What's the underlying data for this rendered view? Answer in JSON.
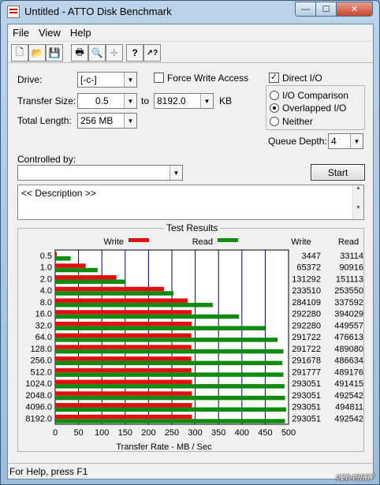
{
  "window": {
    "title": "Untitled - ATTO Disk Benchmark",
    "min_glyph": "—",
    "max_glyph": "☐",
    "close_glyph": "✕"
  },
  "menu": [
    {
      "label": "File"
    },
    {
      "label": "View"
    },
    {
      "label": "Help"
    }
  ],
  "toolbar": {
    "buttons": [
      {
        "name": "new-file-icon",
        "glyph": "🗋"
      },
      {
        "name": "open-folder-icon",
        "glyph": "📂"
      },
      {
        "name": "save-icon",
        "glyph": "💾"
      },
      {
        "name": "print-icon",
        "glyph": "🖶"
      },
      {
        "name": "print-preview-icon",
        "glyph": "🔍"
      },
      {
        "name": "move-icon",
        "glyph": "✛"
      },
      {
        "name": "help-icon",
        "glyph": "?"
      },
      {
        "name": "context-help-icon",
        "glyph": "↗?"
      }
    ]
  },
  "form": {
    "drive_label": "Drive:",
    "drive_value": "[-c-]",
    "force_write_label": "Force Write Access",
    "direct_io_label": "Direct I/O",
    "transfer_size_label": "Transfer Size:",
    "transfer_from": "0.5",
    "to_label": "to",
    "transfer_to": "8192.0",
    "kb_label": "KB",
    "total_length_label": "Total Length:",
    "total_length_value": "256 MB",
    "io_comparison_label": "I/O Comparison",
    "overlapped_io_label": "Overlapped I/O",
    "neither_label": "Neither",
    "queue_depth_label": "Queue Depth:",
    "queue_depth_value": "4",
    "controlled_by_label": "Controlled by:",
    "controlled_by_value": "",
    "start_label": "Start",
    "description_text": "<< Description >>",
    "checked_mark": "✓"
  },
  "results": {
    "title": "Test Results",
    "write_legend": "Write",
    "read_legend": "Read",
    "write_col": "Write",
    "read_col": "Read"
  },
  "chart_data": {
    "type": "bar",
    "orientation": "horizontal",
    "categories": [
      "0.5",
      "1.0",
      "2.0",
      "4.0",
      "8.0",
      "16.0",
      "32.0",
      "64.0",
      "128.0",
      "256.0",
      "512.0",
      "1024.0",
      "2048.0",
      "4096.0",
      "8192.0"
    ],
    "series": [
      {
        "name": "Write",
        "color": "#e01010",
        "values": [
          3447,
          65372,
          131292,
          233510,
          284109,
          292280,
          292280,
          291722,
          291722,
          291678,
          291777,
          293051,
          293051,
          293051,
          293051
        ]
      },
      {
        "name": "Read",
        "color": "#108a10",
        "values": [
          33114,
          90916,
          151113,
          253550,
          337592,
          394029,
          449557,
          476613,
          489080,
          486634,
          489176,
          491415,
          492542,
          494811,
          492542
        ]
      }
    ],
    "xlabel": "Transfer Rate - MB / Sec",
    "xlim": [
      0,
      500
    ],
    "xticks": [
      0,
      50,
      100,
      150,
      200,
      250,
      300,
      350,
      400,
      450,
      500
    ],
    "grid": true,
    "legend": "top"
  },
  "status": {
    "text": "For Help, press F1",
    "watermark": "#2649837"
  },
  "colors": {
    "chart_bg": "#ffffff",
    "grid": "#000080",
    "write": "#e01010",
    "read": "#108a10"
  }
}
